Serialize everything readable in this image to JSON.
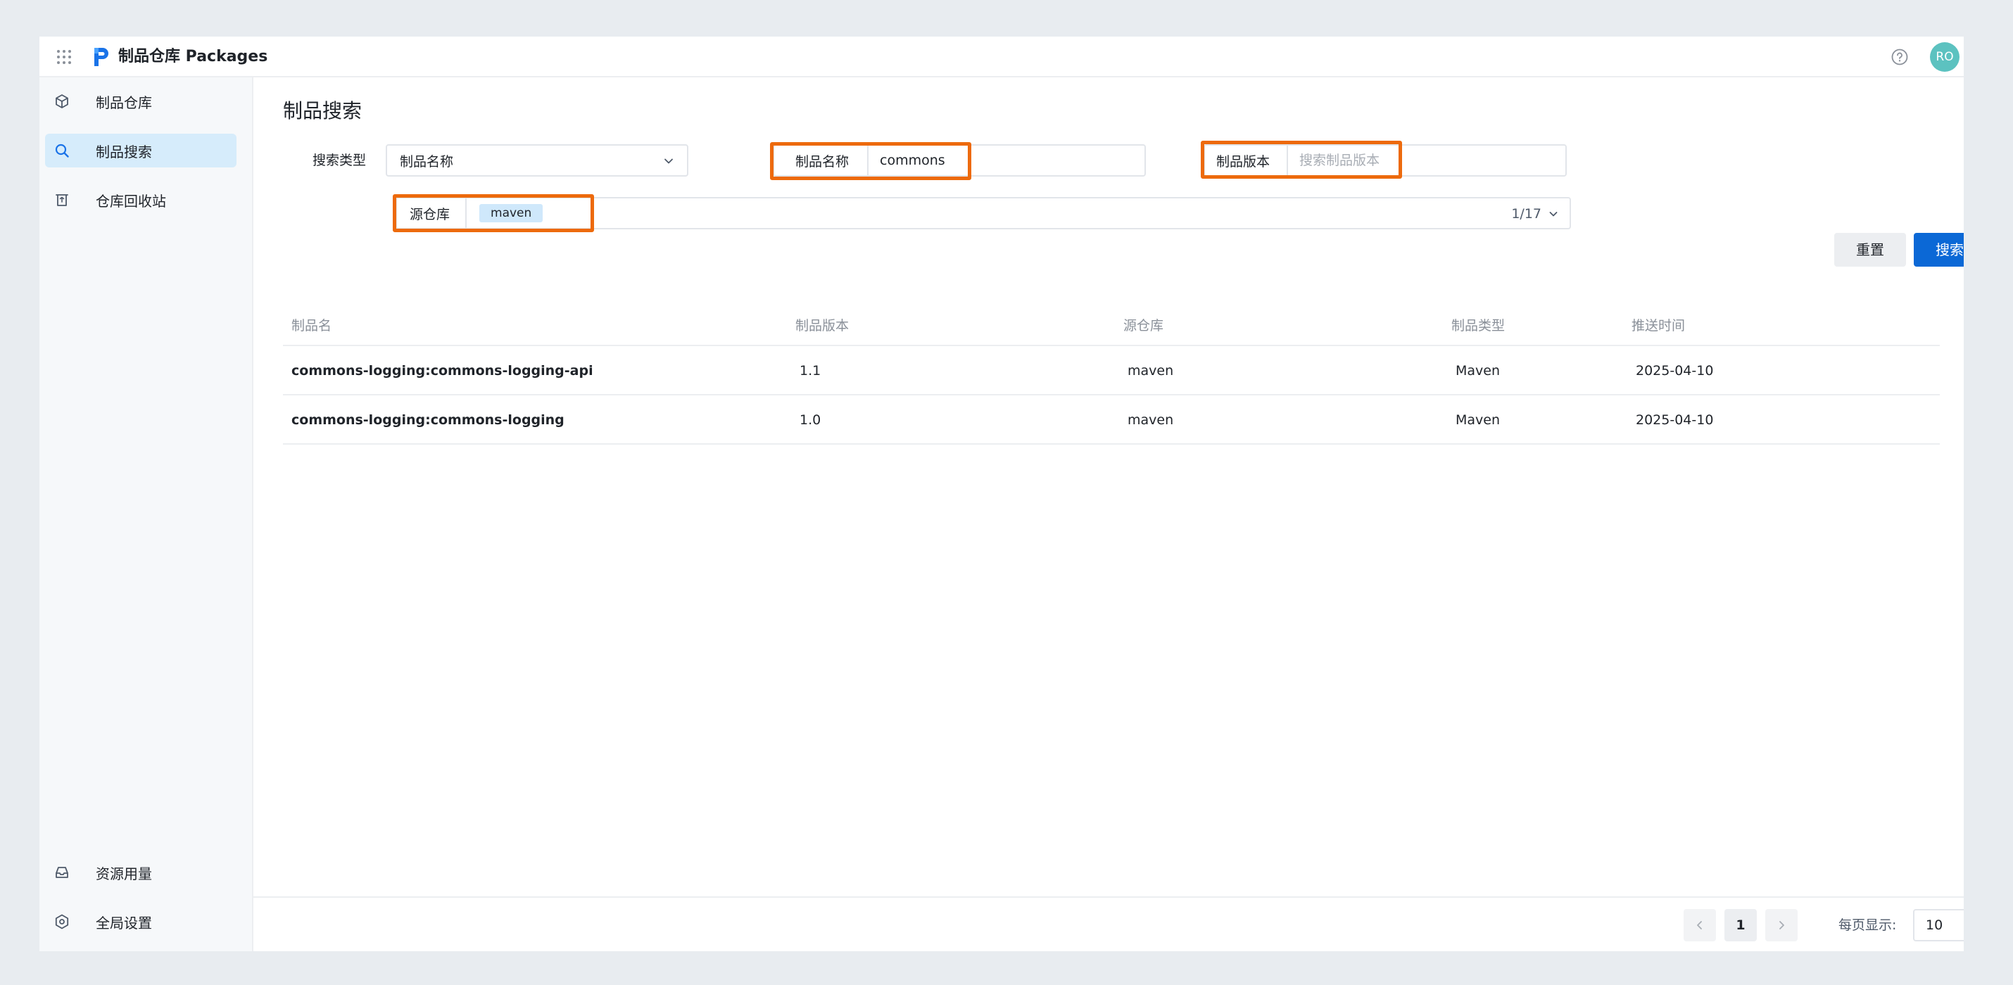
{
  "header": {
    "brand_title": "制品仓库 Packages",
    "avatar_initials": "RO",
    "avatar_color": "#5cc2c0"
  },
  "sidebar": {
    "items": [
      {
        "label": "制品仓库",
        "icon": "cube-icon",
        "active": false
      },
      {
        "label": "制品搜索",
        "icon": "search-icon",
        "active": true
      },
      {
        "label": "仓库回收站",
        "icon": "recycle-bin-icon",
        "active": false
      }
    ],
    "bottom_items": [
      {
        "label": "资源用量",
        "icon": "inbox-icon"
      },
      {
        "label": "全局设置",
        "icon": "settings-icon"
      }
    ]
  },
  "main": {
    "page_title": "制品搜索",
    "filters": {
      "search_type_label": "搜索类型",
      "search_type_value": "制品名称",
      "name_label": "制品名称",
      "name_value": "commons",
      "version_label": "制品版本",
      "version_placeholder": "搜索制品版本",
      "repo_label": "源仓库",
      "repo_tag": "maven",
      "repo_counter": "1/17"
    },
    "buttons": {
      "reset": "重置",
      "search": "搜索"
    },
    "table": {
      "columns": [
        "制品名",
        "制品版本",
        "源仓库",
        "制品类型",
        "推送时间"
      ],
      "rows": [
        {
          "name": "commons-logging:commons-logging-api",
          "version": "1.1",
          "repo": "maven",
          "type": "Maven",
          "time": "2025-04-10"
        },
        {
          "name": "commons-logging:commons-logging",
          "version": "1.0",
          "repo": "maven",
          "type": "Maven",
          "time": "2025-04-10"
        }
      ]
    },
    "pagination": {
      "current_page": "1",
      "per_page_label": "每页显示:",
      "per_page_value": "10"
    }
  },
  "colors": {
    "accent": "#0b68d6",
    "highlight": "#ed6a0c",
    "active_nav": "#d6ecfb",
    "tag_bg": "#cfe8fb"
  }
}
